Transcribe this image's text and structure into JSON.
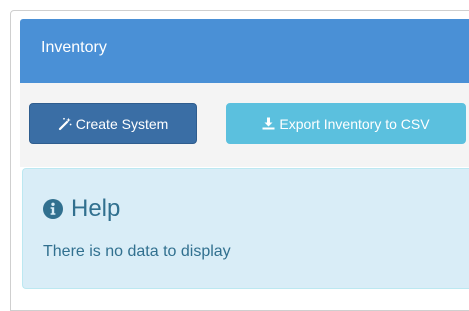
{
  "panel": {
    "title": "Inventory"
  },
  "toolbar": {
    "create_label": "Create System",
    "export_label": "Export Inventory to CSV"
  },
  "alert": {
    "heading": "Help",
    "message": "There is no data to display"
  },
  "colors": {
    "heading_bg": "#4a90d6",
    "create_button": "#3a6ea5",
    "export_button": "#5bc0de",
    "alert_bg": "#d9edf7",
    "alert_text": "#31708f"
  },
  "icons": [
    "magic-wand-icon",
    "download-icon",
    "info-circle-icon"
  ]
}
